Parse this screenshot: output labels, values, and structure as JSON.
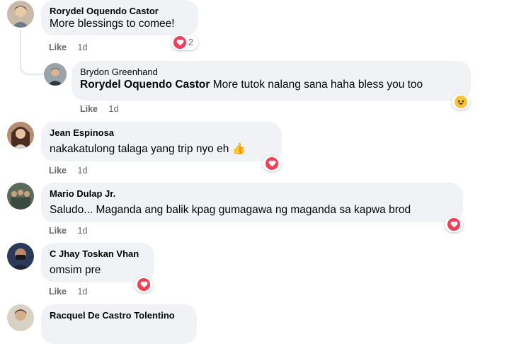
{
  "comments": [
    {
      "author": "Rorydel Oquendo Castor",
      "text": "More blessings to comee!",
      "like_label": "Like",
      "time": "1d",
      "reaction_count": "2"
    },
    {
      "author": "Brydon Greenhand",
      "mention": "Rorydel Oquendo Castor",
      "text": " More tutok nalang sana haha bless you too",
      "like_label": "Like",
      "time": "1d"
    },
    {
      "author": "Jean Espinosa",
      "text": "nakakatulong talaga yang trip nyo eh 👍",
      "like_label": "Like",
      "time": "1d"
    },
    {
      "author": "Mario Dulap Jr.",
      "text": "Saludo... Maganda ang balik kpag gumagawa ng maganda sa kapwa brod",
      "like_label": "Like",
      "time": "1d"
    },
    {
      "author": "C Jhay Toskan Vhan",
      "text": "omsim pre",
      "like_label": "Like",
      "time": "1d"
    },
    {
      "author": "Racquel De Castro Tolentino"
    }
  ],
  "colors": {
    "bubble": "#f0f2f5",
    "heart": "#f33e58",
    "haha": "#f7c33b",
    "muted": "#65676b"
  }
}
